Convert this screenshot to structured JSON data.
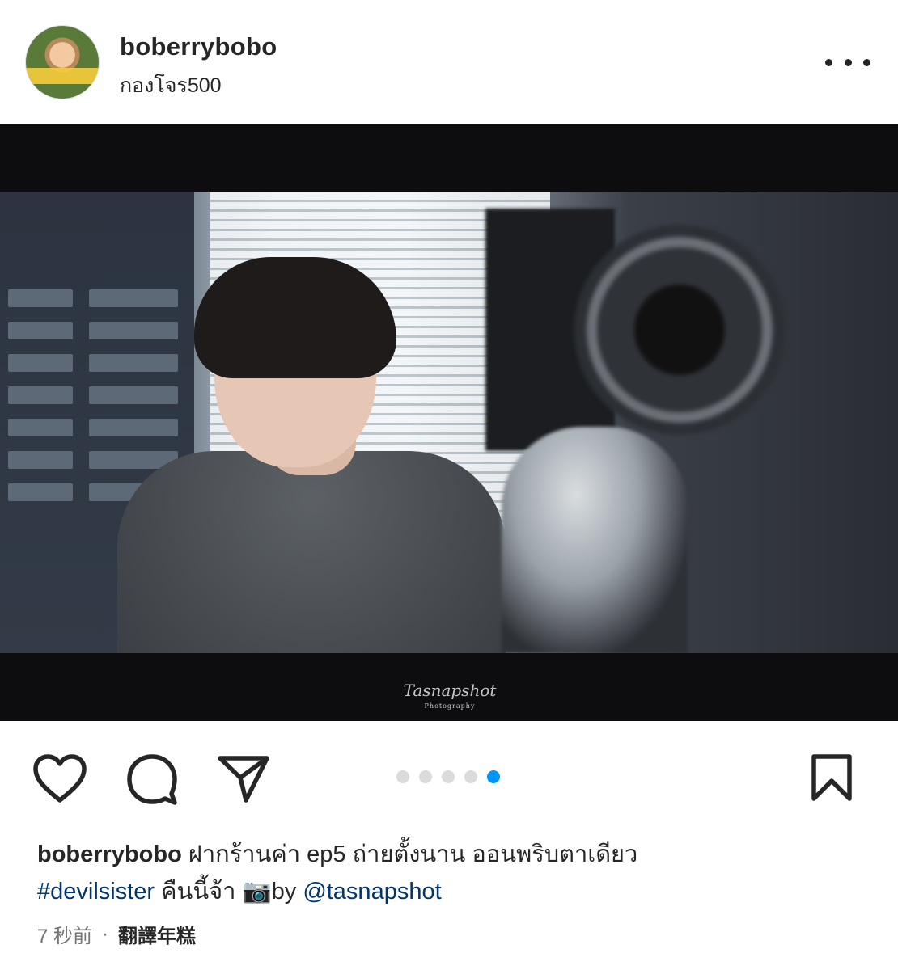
{
  "header": {
    "username": "boberrybobo",
    "location": "กองโจร500"
  },
  "photo": {
    "watermark": "Tasnapshot",
    "watermark_sub": "Photography"
  },
  "carousel": {
    "total": 5,
    "active_index": 4
  },
  "caption": {
    "username": "boberrybobo",
    "text_line1": " ฝากร้านค่า ep5 ถ่ายตั้งนาน ออนพริบตาเดียว",
    "hashtag": "#devilsister",
    "text_line2": " คืนนี้จ้า ",
    "camera_emoji": "📷",
    "by_text": "by ",
    "mention": "@tasnapshot"
  },
  "meta": {
    "timestamp": "7 秒前",
    "separator": "·",
    "translate_label": "翻譯年糕"
  },
  "icons": {
    "more": "more-options-icon",
    "like": "heart-icon",
    "comment": "comment-icon",
    "share": "paper-plane-icon",
    "save": "bookmark-icon"
  },
  "colors": {
    "text": "#262626",
    "link": "#00376b",
    "active_dot": "#0095f6",
    "inactive_dot": "#dbdbdb",
    "muted": "#737373"
  }
}
